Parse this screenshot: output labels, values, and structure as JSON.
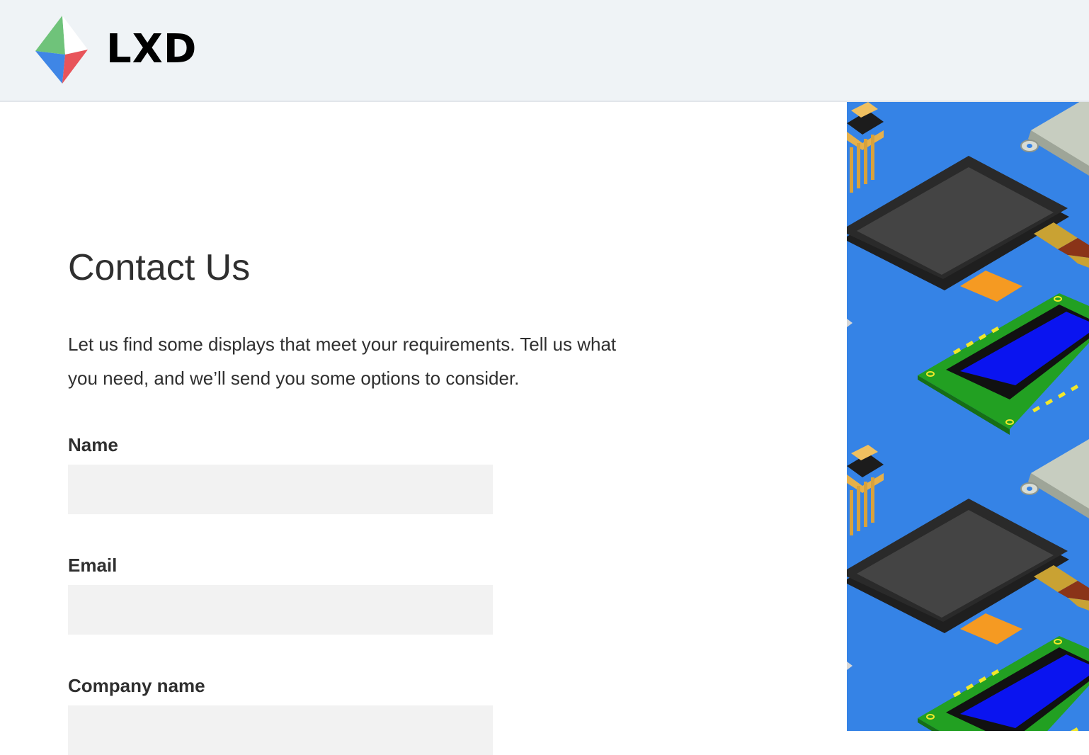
{
  "header": {
    "brand": "LXD",
    "logo_icon": "lxd-logo-icon"
  },
  "main": {
    "title": "Contact Us",
    "intro": "Let us find some displays that meet your requirements. Tell us what you need, and we’ll send you some options to consider.",
    "fields": [
      {
        "label": "Name",
        "value": "",
        "placeholder": ""
      },
      {
        "label": "Email",
        "value": "",
        "placeholder": ""
      },
      {
        "label": "Company name",
        "value": "",
        "placeholder": ""
      }
    ]
  },
  "side_art": {
    "icon": "display-modules-illustration",
    "colors": {
      "background": "#3583e6",
      "tft_frame": "#1f1f1f",
      "tft_screen": "#444444",
      "lcd_board": "#22a022",
      "lcd_screen": "#0a14f0",
      "connector": "#f59a22"
    }
  },
  "colors": {
    "header_bg": "#eff3f6",
    "text": "#2f2f2f",
    "input_bg": "#f2f2f2"
  }
}
